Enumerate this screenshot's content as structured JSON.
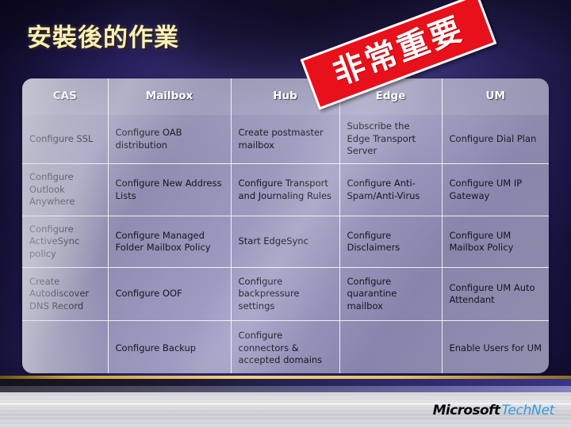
{
  "slide": {
    "title": "安裝後的作業",
    "stamp_label": "非常重要",
    "stamp_color": "#e8111b",
    "title_color": "#f7f0b8"
  },
  "brand": {
    "microsoft": "Microsoft",
    "technet": "TechNet",
    "technet_color": "#3399dd"
  },
  "table": {
    "headers": [
      "CAS",
      "Mailbox",
      "Hub",
      "Edge",
      "UM"
    ],
    "rows": [
      [
        "Configure SSL",
        "Configure OAB distribution",
        "Create postmaster mailbox",
        "Subscribe the Edge Transport Server",
        "Configure Dial Plan"
      ],
      [
        "Configure Outlook Anywhere",
        "Configure New Address Lists",
        "Configure Transport and Journaling Rules",
        "Configure Anti-Spam/Anti-Virus",
        "Configure UM IP Gateway"
      ],
      [
        "Configure ActiveSync policy",
        "Configure Managed Folder Mailbox Policy",
        "Start EdgeSync",
        "Configure Disclaimers",
        "Configure UM Mailbox Policy"
      ],
      [
        "Create Autodiscover DNS Record",
        "Configure OOF",
        "Configure backpressure settings",
        "Configure quarantine mailbox",
        "Configure UM Auto Attendant"
      ],
      [
        "",
        "Configure Backup",
        "Configure connectors & accepted domains",
        "",
        "Enable Users for UM"
      ]
    ]
  }
}
